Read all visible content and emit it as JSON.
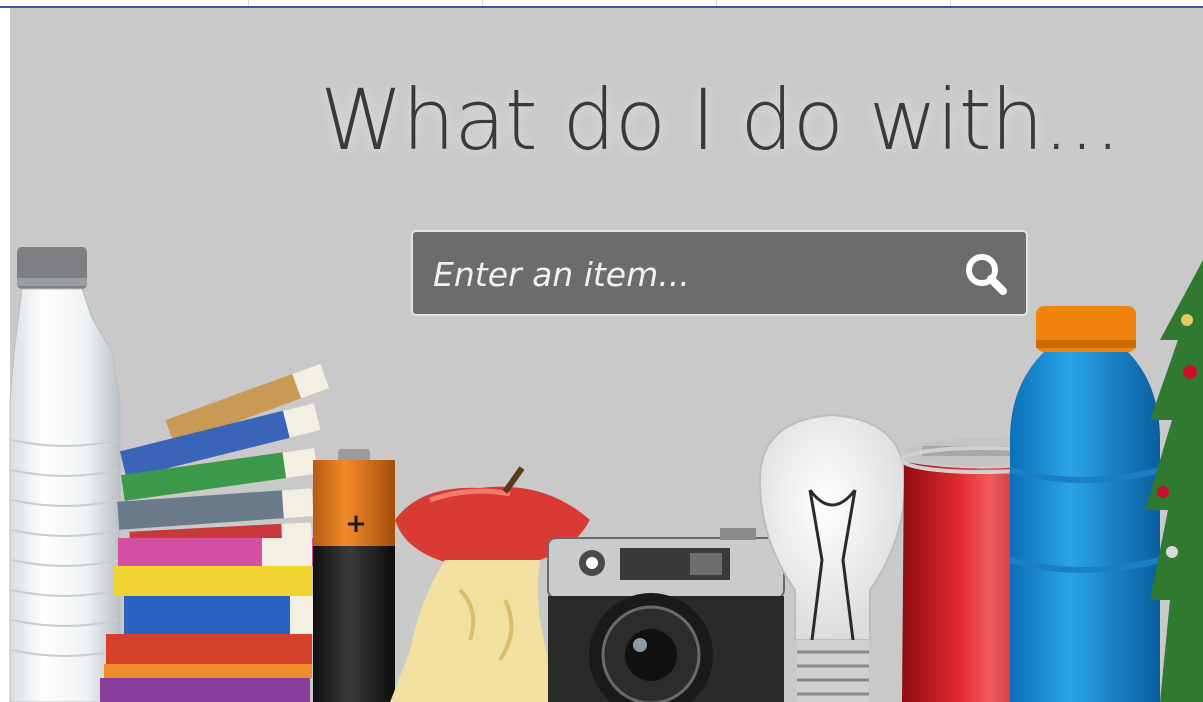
{
  "hero": {
    "title": "What do I do with..."
  },
  "search": {
    "placeholder": "Enter an item...",
    "icon": "search-icon"
  },
  "decor": {
    "items": [
      "water-bottle",
      "book-stack",
      "battery",
      "apple-core",
      "camera",
      "light-bulb",
      "soda-can",
      "sports-drink-bottle",
      "christmas-tree"
    ],
    "battery_mark": "+"
  },
  "colors": {
    "background": "#c9c9c9",
    "search_bg": "#6c6c6c",
    "title": "#3a3a3a",
    "top_rule": "#3b56a8"
  }
}
